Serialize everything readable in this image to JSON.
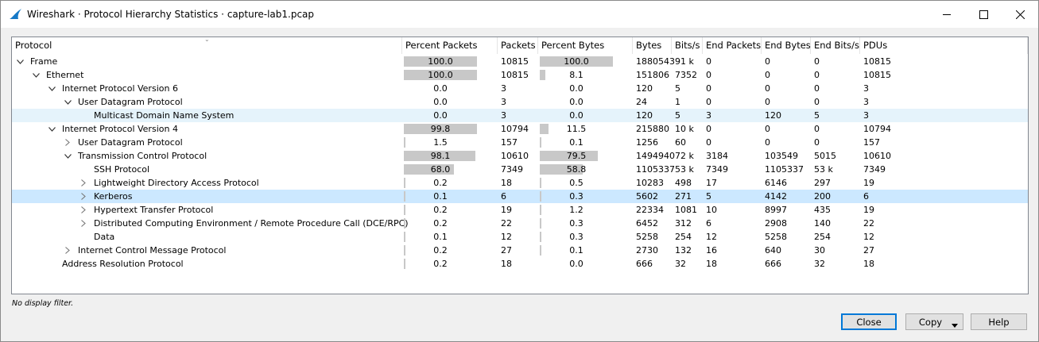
{
  "window": {
    "title": "Wireshark · Protocol Hierarchy Statistics · capture-lab1.pcap"
  },
  "columns": [
    "Protocol",
    "Percent Packets",
    "Packets",
    "Percent Bytes",
    "Bytes",
    "Bits/s",
    "End Packets",
    "End Bytes",
    "End Bits/s",
    "PDUs"
  ],
  "rows": [
    {
      "protocol": "Frame",
      "level": 0,
      "toggle": "expanded",
      "pct_packets": "100.0",
      "pct_packets_value": 100.0,
      "packets": "10815",
      "pct_bytes": "100.0",
      "pct_bytes_value": 100.0,
      "bytes": "1880543",
      "bits": "91 k",
      "end_packets": "0",
      "end_bytes": "0",
      "end_bits": "0",
      "pdus": "10815",
      "selected": ""
    },
    {
      "protocol": "Ethernet",
      "level": 1,
      "toggle": "expanded",
      "pct_packets": "100.0",
      "pct_packets_value": 100.0,
      "packets": "10815",
      "pct_bytes": "8.1",
      "pct_bytes_value": 8.1,
      "bytes": "151806",
      "bits": "7352",
      "end_packets": "0",
      "end_bytes": "0",
      "end_bits": "0",
      "pdus": "10815",
      "selected": ""
    },
    {
      "protocol": "Internet Protocol Version 6",
      "level": 2,
      "toggle": "expanded",
      "pct_packets": "0.0",
      "pct_packets_value": 0.0,
      "packets": "3",
      "pct_bytes": "0.0",
      "pct_bytes_value": 0.0,
      "bytes": "120",
      "bits": "5",
      "end_packets": "0",
      "end_bytes": "0",
      "end_bits": "0",
      "pdus": "3",
      "selected": ""
    },
    {
      "protocol": "User Datagram Protocol",
      "level": 3,
      "toggle": "expanded",
      "pct_packets": "0.0",
      "pct_packets_value": 0.0,
      "packets": "3",
      "pct_bytes": "0.0",
      "pct_bytes_value": 0.0,
      "bytes": "24",
      "bits": "1",
      "end_packets": "0",
      "end_bytes": "0",
      "end_bits": "0",
      "pdus": "3",
      "selected": ""
    },
    {
      "protocol": "Multicast Domain Name System",
      "level": 4,
      "toggle": "none",
      "pct_packets": "0.0",
      "pct_packets_value": 0.0,
      "packets": "3",
      "pct_bytes": "0.0",
      "pct_bytes_value": 0.0,
      "bytes": "120",
      "bits": "5",
      "end_packets": "3",
      "end_bytes": "120",
      "end_bits": "5",
      "pdus": "3",
      "selected": "hover"
    },
    {
      "protocol": "Internet Protocol Version 4",
      "level": 2,
      "toggle": "expanded",
      "pct_packets": "99.8",
      "pct_packets_value": 99.8,
      "packets": "10794",
      "pct_bytes": "11.5",
      "pct_bytes_value": 11.5,
      "bytes": "215880",
      "bits": "10 k",
      "end_packets": "0",
      "end_bytes": "0",
      "end_bits": "0",
      "pdus": "10794",
      "selected": ""
    },
    {
      "protocol": "User Datagram Protocol",
      "level": 3,
      "toggle": "collapsed",
      "pct_packets": "1.5",
      "pct_packets_value": 1.5,
      "packets": "157",
      "pct_bytes": "0.1",
      "pct_bytes_value": 0.1,
      "bytes": "1256",
      "bits": "60",
      "end_packets": "0",
      "end_bytes": "0",
      "end_bits": "0",
      "pdus": "157",
      "selected": ""
    },
    {
      "protocol": "Transmission Control Protocol",
      "level": 3,
      "toggle": "expanded",
      "pct_packets": "98.1",
      "pct_packets_value": 98.1,
      "packets": "10610",
      "pct_bytes": "79.5",
      "pct_bytes_value": 79.5,
      "bytes": "1494940",
      "bits": "72 k",
      "end_packets": "3184",
      "end_bytes": "103549",
      "end_bits": "5015",
      "pdus": "10610",
      "selected": ""
    },
    {
      "protocol": "SSH Protocol",
      "level": 4,
      "toggle": "none",
      "pct_packets": "68.0",
      "pct_packets_value": 68.0,
      "packets": "7349",
      "pct_bytes": "58.8",
      "pct_bytes_value": 58.8,
      "bytes": "1105337",
      "bits": "53 k",
      "end_packets": "7349",
      "end_bytes": "1105337",
      "end_bits": "53 k",
      "pdus": "7349",
      "selected": ""
    },
    {
      "protocol": "Lightweight Directory Access Protocol",
      "level": 4,
      "toggle": "collapsed",
      "pct_packets": "0.2",
      "pct_packets_value": 0.2,
      "packets": "18",
      "pct_bytes": "0.5",
      "pct_bytes_value": 0.5,
      "bytes": "10283",
      "bits": "498",
      "end_packets": "17",
      "end_bytes": "6146",
      "end_bits": "297",
      "pdus": "19",
      "selected": ""
    },
    {
      "protocol": "Kerberos",
      "level": 4,
      "toggle": "collapsed",
      "pct_packets": "0.1",
      "pct_packets_value": 0.1,
      "packets": "6",
      "pct_bytes": "0.3",
      "pct_bytes_value": 0.3,
      "bytes": "5602",
      "bits": "271",
      "end_packets": "5",
      "end_bytes": "4142",
      "end_bits": "200",
      "pdus": "6",
      "selected": "selected"
    },
    {
      "protocol": "Hypertext Transfer Protocol",
      "level": 4,
      "toggle": "collapsed",
      "pct_packets": "0.2",
      "pct_packets_value": 0.2,
      "packets": "19",
      "pct_bytes": "1.2",
      "pct_bytes_value": 1.2,
      "bytes": "22334",
      "bits": "1081",
      "end_packets": "10",
      "end_bytes": "8997",
      "end_bits": "435",
      "pdus": "19",
      "selected": ""
    },
    {
      "protocol": "Distributed Computing Environment / Remote Procedure Call (DCE/RPC)",
      "level": 4,
      "toggle": "collapsed",
      "pct_packets": "0.2",
      "pct_packets_value": 0.2,
      "packets": "22",
      "pct_bytes": "0.3",
      "pct_bytes_value": 0.3,
      "bytes": "6452",
      "bits": "312",
      "end_packets": "6",
      "end_bytes": "2908",
      "end_bits": "140",
      "pdus": "22",
      "selected": ""
    },
    {
      "protocol": "Data",
      "level": 4,
      "toggle": "none",
      "pct_packets": "0.1",
      "pct_packets_value": 0.1,
      "packets": "12",
      "pct_bytes": "0.3",
      "pct_bytes_value": 0.3,
      "bytes": "5258",
      "bits": "254",
      "end_packets": "12",
      "end_bytes": "5258",
      "end_bits": "254",
      "pdus": "12",
      "selected": ""
    },
    {
      "protocol": "Internet Control Message Protocol",
      "level": 3,
      "toggle": "collapsed",
      "pct_packets": "0.2",
      "pct_packets_value": 0.2,
      "packets": "27",
      "pct_bytes": "0.1",
      "pct_bytes_value": 0.1,
      "bytes": "2730",
      "bits": "132",
      "end_packets": "16",
      "end_bytes": "640",
      "end_bits": "30",
      "pdus": "27",
      "selected": ""
    },
    {
      "protocol": "Address Resolution Protocol",
      "level": 2,
      "toggle": "none",
      "pct_packets": "0.2",
      "pct_packets_value": 0.2,
      "packets": "18",
      "pct_bytes": "0.0",
      "pct_bytes_value": 0.0,
      "bytes": "666",
      "bits": "32",
      "end_packets": "18",
      "end_bytes": "666",
      "end_bits": "32",
      "pdus": "18",
      "selected": ""
    }
  ],
  "status": {
    "filter_text": "No display filter."
  },
  "buttons": {
    "close": "Close",
    "copy": "Copy",
    "help": "Help"
  },
  "colors": {
    "bar": "#c8c8c8",
    "hover_row": "#e5f3fb",
    "selected_row": "#cce8ff",
    "accent": "#0078d7"
  }
}
